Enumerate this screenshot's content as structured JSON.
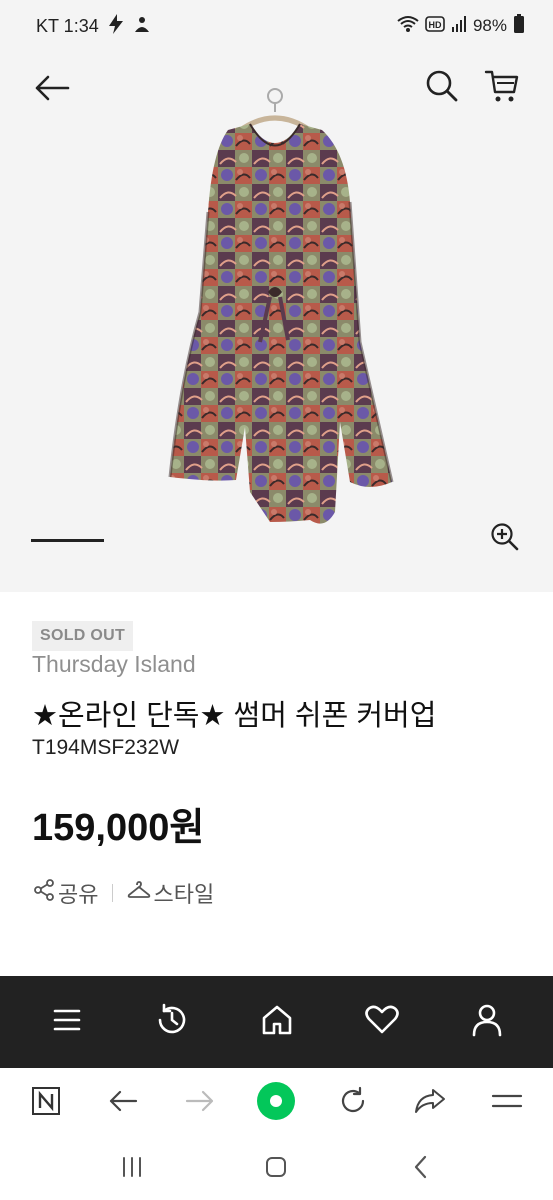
{
  "status_bar": {
    "carrier_time": "KT 1:34",
    "battery": "98%",
    "icons": [
      "bolt-icon",
      "app-icon",
      "wifi-icon",
      "hd-icon",
      "signal-icon",
      "battery-icon"
    ]
  },
  "header": {
    "icons": [
      "back-arrow-icon",
      "search-icon",
      "cart-icon"
    ]
  },
  "product": {
    "badge": "SOLD OUT",
    "brand": "Thursday Island",
    "title": "★온라인 단독★ 썸머 쉬폰 커버업",
    "code": "T194MSF232W",
    "price": "159,000원",
    "actions": {
      "share_label": "공유",
      "style_label": "스타일"
    }
  },
  "app_nav": {
    "icons": [
      "menu-icon",
      "history-icon",
      "home-icon",
      "heart-icon",
      "user-icon"
    ]
  },
  "browser_bar": {
    "icons": [
      "naver-icon",
      "back-icon",
      "forward-icon",
      "green-dot-icon",
      "refresh-icon",
      "share-icon",
      "menu-icon"
    ],
    "accent": "#03c75a"
  },
  "system_nav": {
    "icons": [
      "recents-icon",
      "home-icon",
      "back-icon"
    ]
  },
  "colors": {
    "nav_background": "#222222",
    "hero_background": "#f4f4f4",
    "badge_background": "#efefef"
  }
}
